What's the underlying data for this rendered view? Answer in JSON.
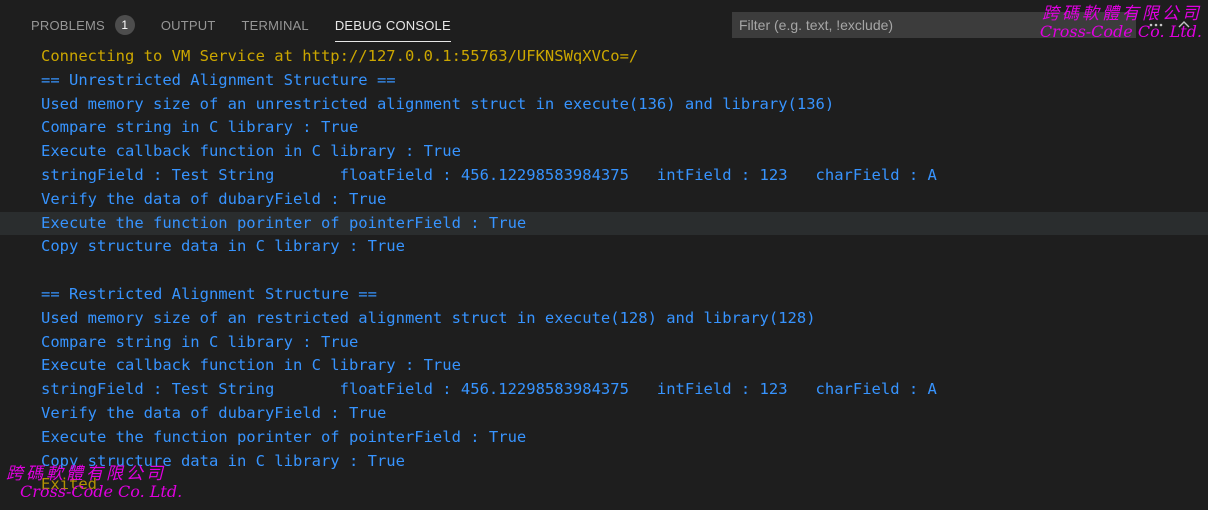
{
  "panel": {
    "tabs": [
      {
        "label": "PROBLEMS",
        "badge": "1",
        "active": false
      },
      {
        "label": "OUTPUT",
        "active": false
      },
      {
        "label": "TERMINAL",
        "active": false
      },
      {
        "label": "DEBUG CONSOLE",
        "active": true
      }
    ],
    "filter": {
      "placeholder": "Filter (e.g. text, !exclude)",
      "value": ""
    }
  },
  "icons": {
    "more": "ellipsis-icon",
    "collapse": "chevron-up-icon",
    "close": "close-icon"
  },
  "console": {
    "lines": [
      "Connecting to VM Service at http://127.0.0.1:55763/UFKNSWqXVCo=/",
      "== Unrestricted Alignment Structure ==",
      "Used memory size of an unrestricted alignment struct in execute(136) and library(136)",
      "Compare string in C library : True",
      "Execute callback function in C library : True",
      "stringField : Test String       floatField : 456.12298583984375   intField : 123   charField : A",
      "Verify the data of dubaryField : True",
      "Execute the function porinter of pointerField : True",
      "Copy structure data in C library : True",
      "",
      "== Restricted Alignment Structure ==",
      "Used memory size of an restricted alignment struct in execute(128) and library(128)",
      "Compare string in C library : True",
      "Execute callback function in C library : True",
      "stringField : Test String       floatField : 456.12298583984375   intField : 123   charField : A",
      "Verify the data of dubaryField : True",
      "Execute the function porinter of pointerField : True",
      "Copy structure data in C library : True",
      "Exited"
    ]
  },
  "watermark": {
    "chinese": "跨碼軟體有限公司",
    "english": "Cross-Code Co. Ltd."
  },
  "colors": {
    "background": "#1e1e1e",
    "output_blue": "#3794ff",
    "warning_yellow": "#cca700",
    "watermark_magenta": "#e000e0"
  }
}
